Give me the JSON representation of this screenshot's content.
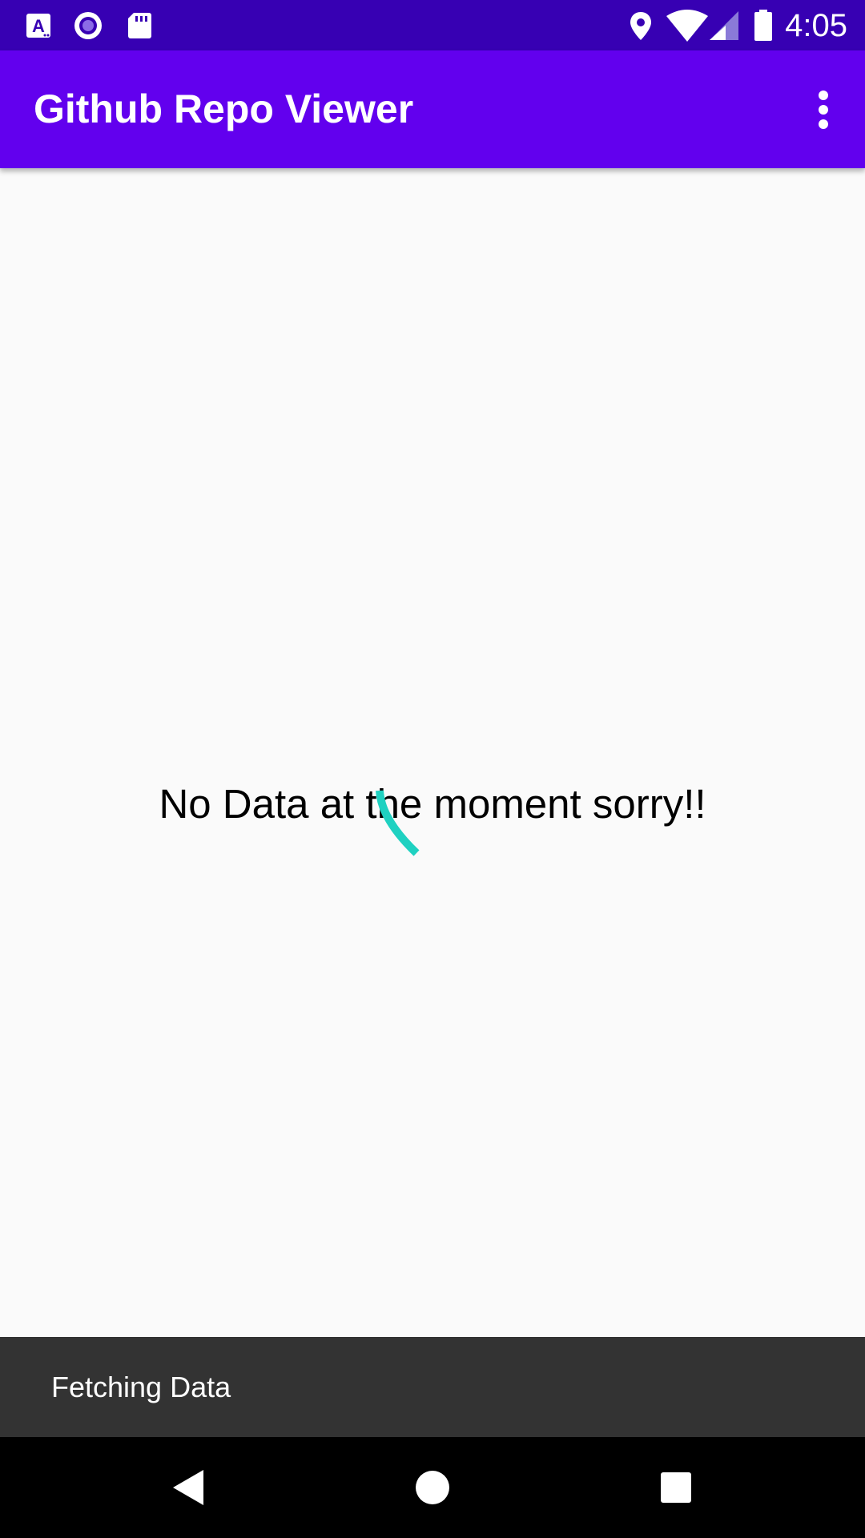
{
  "status_bar": {
    "time": "4:05",
    "left_icons": [
      "accessibility-a-icon",
      "record-circle-icon",
      "sd-card-icon"
    ],
    "right_icons": [
      "location-pin-icon",
      "wifi-icon",
      "cell-signal-icon",
      "battery-icon"
    ]
  },
  "app_bar": {
    "title": "Github Repo Viewer",
    "menu_icon": "more-vert-icon"
  },
  "content": {
    "empty_message": "No Data at the moment sorry!!",
    "spinner_icon": "loading-spinner-icon"
  },
  "snackbar": {
    "message": "Fetching Data"
  },
  "nav_bar": {
    "buttons": [
      "back-triangle-icon",
      "home-circle-icon",
      "recents-square-icon"
    ]
  },
  "colors": {
    "status_bar": "#3700b3",
    "app_bar": "#6200ee",
    "background": "#fafafa",
    "spinner": "#1fd1c1",
    "snackbar": "#333333",
    "nav_bar": "#000000"
  }
}
